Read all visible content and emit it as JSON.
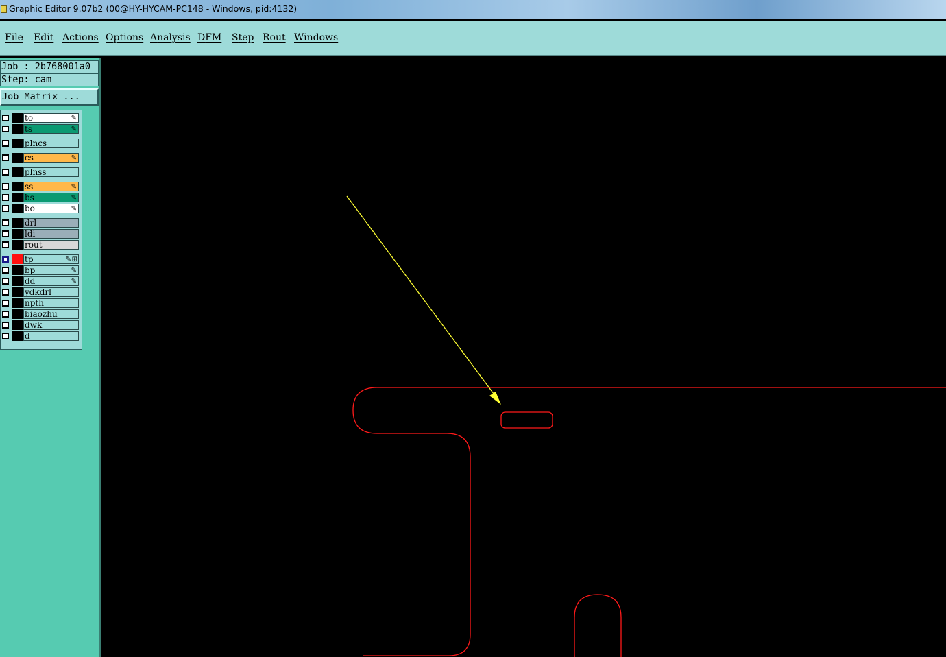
{
  "window": {
    "title": "Graphic Editor 9.07b2 (00@HY-HYCAM-PC148 - Windows, pid:4132)"
  },
  "menu": {
    "items": [
      {
        "label": "File"
      },
      {
        "label": "Edit"
      },
      {
        "label": "Actions"
      },
      {
        "label": "Options"
      },
      {
        "label": "Analysis"
      },
      {
        "label": "DFM"
      },
      {
        "label": "Step"
      },
      {
        "label": "Rout"
      },
      {
        "label": "Windows"
      }
    ]
  },
  "panel": {
    "job": "Job : 2b768001a0",
    "step": "Step: cam",
    "job_matrix": "Job Matrix ..."
  },
  "layers": [
    {
      "name": "to",
      "color": "#ffffff",
      "editable": true
    },
    {
      "name": "ts",
      "color": "#0a9a72",
      "editable": true
    },
    {
      "name": "plncs",
      "color": "#9edbd9",
      "editable": false
    },
    {
      "name": "cs",
      "color": "#ffb84a",
      "editable": true
    },
    {
      "name": "plnss",
      "color": "#9edbd9",
      "editable": false
    },
    {
      "name": "ss",
      "color": "#ffb84a",
      "editable": true
    },
    {
      "name": "bs",
      "color": "#0a9a72",
      "editable": true
    },
    {
      "name": "bo",
      "color": "#ffffff",
      "editable": true
    },
    {
      "name": "drl",
      "color": "#9aaeb8",
      "editable": false
    },
    {
      "name": "ldi",
      "color": "#9aaeb8",
      "editable": false
    },
    {
      "name": "rout",
      "color": "#d8d8d8",
      "editable": false
    },
    {
      "name": "tp",
      "color": "#9edbd9",
      "editable": true,
      "active": true,
      "display_color": "#ff1010"
    },
    {
      "name": "bp",
      "color": "#9edbd9",
      "editable": true
    },
    {
      "name": "dd",
      "color": "#9edbd9",
      "editable": true
    },
    {
      "name": "ydkdrl",
      "color": "#9edbd9",
      "editable": false
    },
    {
      "name": "npth",
      "color": "#9edbd9",
      "editable": false
    },
    {
      "name": "biaozhu",
      "color": "#9edbd9",
      "editable": false
    },
    {
      "name": "dwk",
      "color": "#9edbd9",
      "editable": false
    },
    {
      "name": "d",
      "color": "#9edbd9",
      "editable": false
    }
  ],
  "canvas": {
    "background": "#000000",
    "outline_color": "#ff1a1a",
    "annotation_color": "#ffff33"
  }
}
